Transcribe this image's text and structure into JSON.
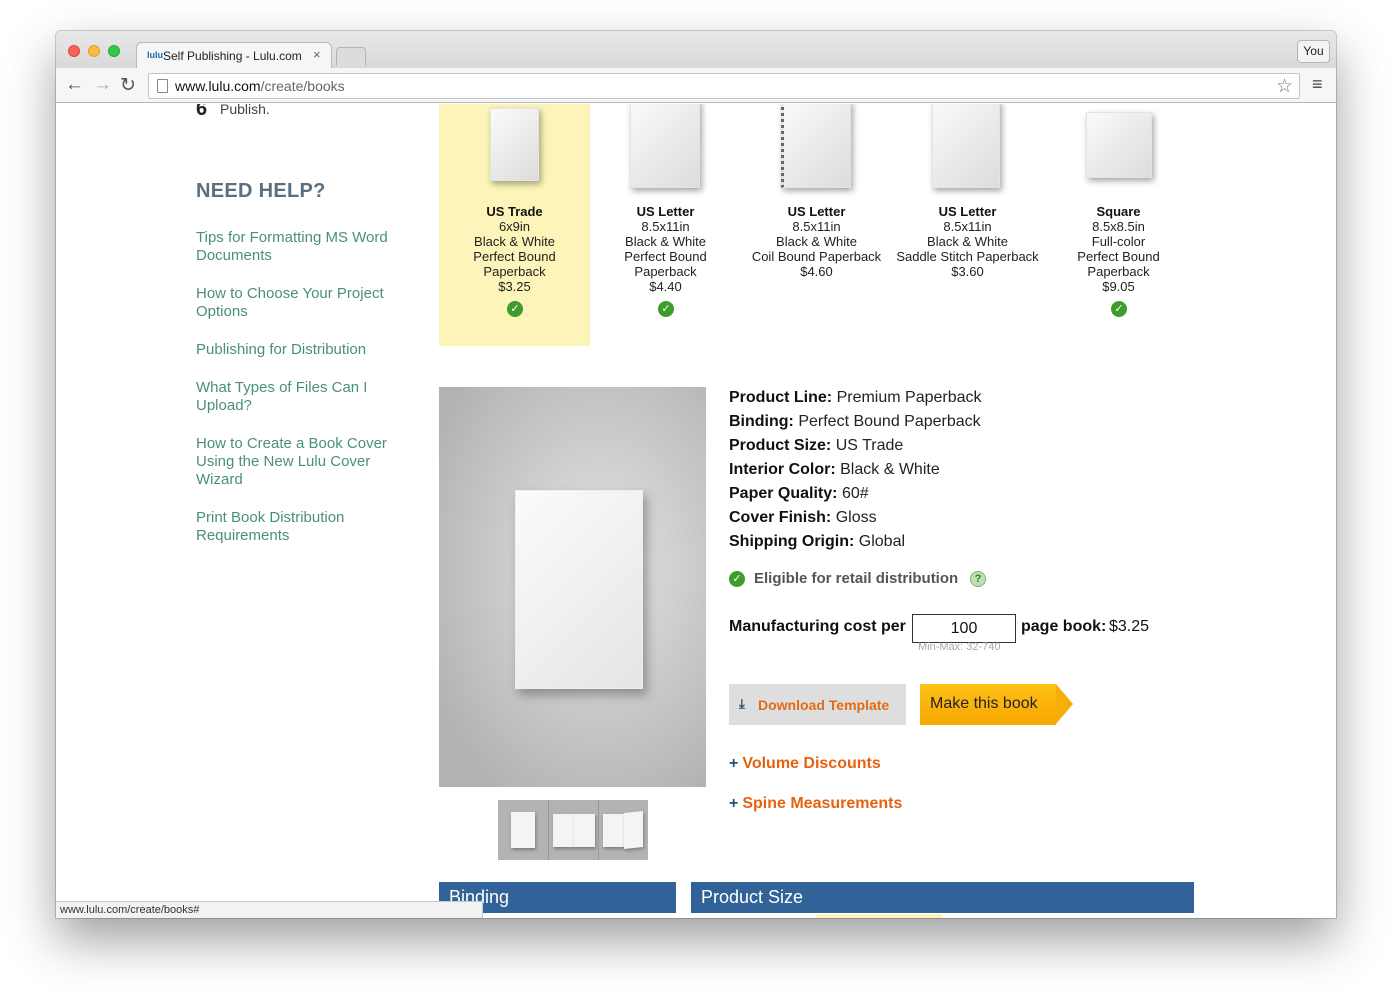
{
  "browser": {
    "tab_title": "Self Publishing - Lulu.com",
    "tab_favicon_text": "lulu",
    "tab_close": "×",
    "profile_label": "You",
    "url_host": "www.lulu.com",
    "url_path": "/create/books",
    "back_icon": "back-arrow-icon",
    "forward_icon": "forward-arrow-icon",
    "reload_icon": "reload-icon",
    "star_icon": "bookmark-star-icon",
    "menu_icon": "hamburger-menu-icon"
  },
  "steps": {
    "last_number": "6",
    "last_label": "Publish."
  },
  "help": {
    "title": "NEED HELP?",
    "links": [
      "Tips for Formatting MS Word Documents",
      "How to Choose Your Project Options",
      "Publishing for Distribution",
      "What Types of Files Can I Upload?",
      "How to Create a Book Cover Using the New Lulu Cover Wizard",
      "Print Book Distribution Requirements"
    ]
  },
  "sizes": [
    {
      "name": "US Trade",
      "detail": "6x9in\nBlack & White\nPerfect Bound\nPaperback\n$3.25",
      "eligible": true,
      "selected": true
    },
    {
      "name": "US Letter",
      "detail": "8.5x11in\nBlack & White\nPerfect Bound\nPaperback\n$4.40",
      "eligible": true,
      "selected": false
    },
    {
      "name": "US Letter",
      "detail": "8.5x11in\nBlack & White\nCoil Bound Paperback\n$4.60",
      "eligible": false,
      "selected": false
    },
    {
      "name": "US Letter",
      "detail": "8.5x11in\nBlack & White\nSaddle Stitch Paperback\n$3.60",
      "eligible": false,
      "selected": false
    },
    {
      "name": "Square",
      "detail": "8.5x8.5in\nFull-color\nPerfect Bound\nPaperback\n$9.05",
      "eligible": true,
      "selected": false
    }
  ],
  "product": {
    "specs": [
      {
        "label": "Product Line:",
        "value": "Premium Paperback"
      },
      {
        "label": "Binding:",
        "value": "Perfect Bound Paperback"
      },
      {
        "label": "Product Size:",
        "value": "US Trade"
      },
      {
        "label": "Interior Color:",
        "value": "Black & White"
      },
      {
        "label": "Paper Quality:",
        "value": "60#"
      },
      {
        "label": "Cover Finish:",
        "value": "Gloss"
      },
      {
        "label": "Shipping Origin:",
        "value": "Global"
      }
    ],
    "eligible_text": "Eligible for retail distribution",
    "help_mark": "?",
    "cost_label_prefix": "Manufacturing cost per",
    "page_count": "100",
    "cost_label_suffix": "page book:",
    "cost_value": "$3.25",
    "min_max": "Min-Max: 32-740"
  },
  "actions": {
    "download_template": "Download Template",
    "make_book": "Make this book",
    "volume_discounts": "Volume Discounts",
    "spine_measurements": "Spine Measurements",
    "plus": "+"
  },
  "sections": {
    "binding": "Binding",
    "product_size": "Product Size"
  },
  "status_url": "www.lulu.com/create/books#",
  "colors": {
    "accent_orange": "#e6620e",
    "link_green": "#4a8f7d",
    "section_blue": "#316399",
    "selected_yellow": "#fcf4b8",
    "check_green": "#3f9b2c"
  }
}
